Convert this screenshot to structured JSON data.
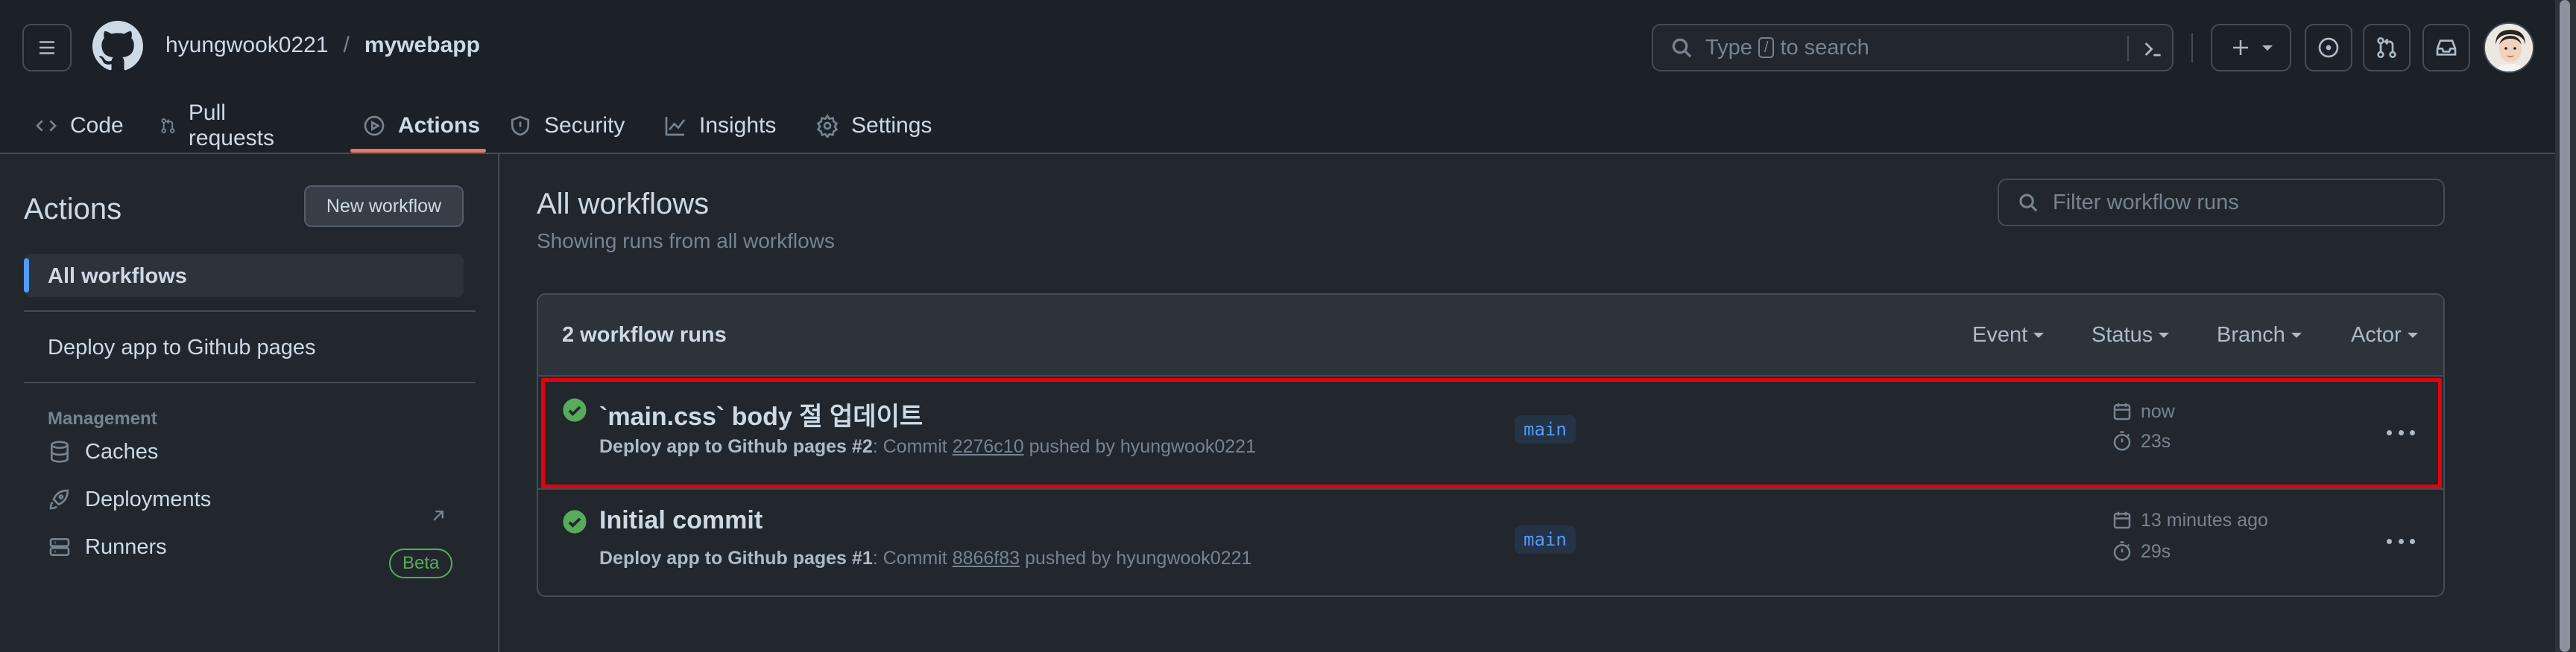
{
  "header": {
    "owner": "hyungwook0221",
    "separator": "/",
    "repo": "mywebapp",
    "search_prefix": "Type",
    "search_key": "/",
    "search_suffix": "to search"
  },
  "repo_nav": {
    "items": [
      {
        "label": "Code",
        "icon": "code-icon"
      },
      {
        "label": "Pull requests",
        "icon": "pull-request-icon"
      },
      {
        "label": "Actions",
        "icon": "play-icon",
        "active": true
      },
      {
        "label": "Security",
        "icon": "shield-icon"
      },
      {
        "label": "Insights",
        "icon": "graph-icon"
      },
      {
        "label": "Settings",
        "icon": "gear-icon"
      }
    ]
  },
  "sidebar": {
    "title": "Actions",
    "new_workflow": "New workflow",
    "all_workflows": "All workflows",
    "workflows": [
      "Deploy app to Github pages"
    ],
    "management_title": "Management",
    "management": [
      {
        "label": "Caches",
        "icon": "database-icon"
      },
      {
        "label": "Deployments",
        "icon": "rocket-icon"
      },
      {
        "label": "Runners",
        "icon": "server-icon",
        "badge": "Beta"
      }
    ]
  },
  "main": {
    "title": "All workflows",
    "subtitle": "Showing runs from all workflows",
    "filter_placeholder": "Filter workflow runs",
    "runs_count": "2 workflow runs",
    "filters": [
      "Event",
      "Status",
      "Branch",
      "Actor"
    ],
    "runs": [
      {
        "title": "`main.css` body 절 업데이트",
        "workflow": "Deploy app to Github pages",
        "run_number": "#2",
        "commit_prefix": ": Commit ",
        "sha": "2276c10",
        "pushed_by": " pushed by hyungwook0221",
        "branch": "main",
        "time": "now",
        "duration": "23s",
        "status": "success"
      },
      {
        "title": "Initial commit",
        "workflow": "Deploy app to Github pages",
        "run_number": "#1",
        "commit_prefix": ": Commit ",
        "sha": "8866f83",
        "pushed_by": " pushed by hyungwook0221",
        "branch": "main",
        "time": "13 minutes ago",
        "duration": "29s",
        "status": "success"
      }
    ]
  },
  "colors": {
    "accent_underline": "#ec775c",
    "success": "#57ab5a",
    "highlight_box": "#e5000b",
    "link_blue": "#539bf5"
  }
}
